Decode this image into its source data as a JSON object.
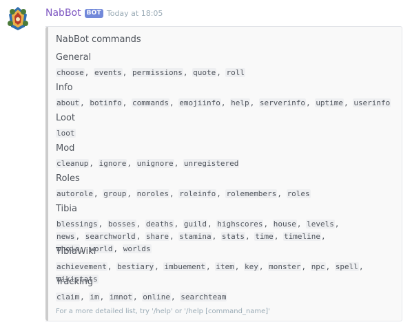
{
  "message": {
    "username": "NabBot",
    "bot_tag": "BOT",
    "timestamp": "Today at 18:05"
  },
  "embed": {
    "title": "NabBot commands",
    "footer": "For a more detailed list, try '/help' or '/help [command_name]'",
    "sections": [
      {
        "name": "General",
        "commands": [
          "choose",
          "events",
          "permissions",
          "quote",
          "roll"
        ]
      },
      {
        "name": "Info",
        "commands": [
          "about",
          "botinfo",
          "commands",
          "emojiinfo",
          "help",
          "serverinfo",
          "uptime",
          "userinfo"
        ]
      },
      {
        "name": "Loot",
        "commands": [
          "loot"
        ]
      },
      {
        "name": "Mod",
        "commands": [
          "cleanup",
          "ignore",
          "unignore",
          "unregistered"
        ]
      },
      {
        "name": "Roles",
        "commands": [
          "autorole",
          "group",
          "noroles",
          "roleinfo",
          "rolemembers",
          "roles"
        ]
      },
      {
        "name": "Tibia",
        "commands": [
          "blessings",
          "bosses",
          "deaths",
          "guild",
          "highscores",
          "house",
          "levels",
          "news",
          "searchworld",
          "share",
          "stamina",
          "stats",
          "time",
          "timeline",
          "whois",
          "world",
          "worlds"
        ]
      },
      {
        "name": "TibiaWiki",
        "commands": [
          "achievement",
          "bestiary",
          "imbuement",
          "item",
          "key",
          "monster",
          "npc",
          "spell",
          "wikistats"
        ]
      },
      {
        "name": "Tracking",
        "commands": [
          "claim",
          "im",
          "imnot",
          "online",
          "searchteam"
        ]
      }
    ]
  },
  "colors": {
    "username": "#7e57c2",
    "bot_tag_bg": "#7289da",
    "embed_bar": "#cccccc"
  },
  "icons": {
    "avatar": "nabbot-avatar-icon"
  }
}
